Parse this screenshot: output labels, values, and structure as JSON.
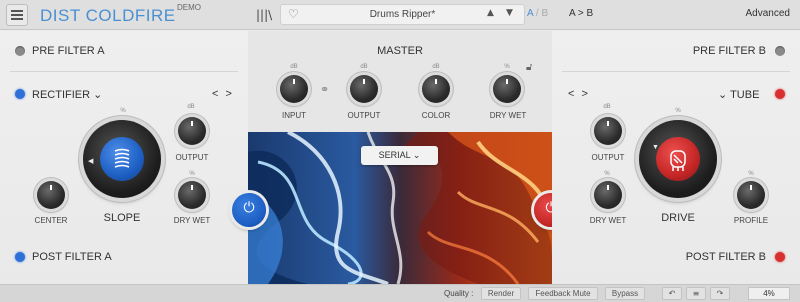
{
  "topbar": {
    "brand": "DIST COLDFIRE",
    "demo": "DEMO",
    "preset_name": "Drums Ripper*",
    "ab_a": "A",
    "ab_sep": "/",
    "ab_b": "B",
    "a_to_b": "A > B",
    "advanced": "Advanced",
    "icons": [
      "menu-icon",
      "library-icon",
      "heart-icon",
      "arrow-up-icon",
      "arrow-down-icon"
    ]
  },
  "left": {
    "pre_filter": "PRE FILTER A",
    "mode": "RECTIFIER",
    "mode_arrow": "⌄",
    "nav": "< >",
    "output": "OUTPUT",
    "output_unit": "dB",
    "slope": "SLOPE",
    "slope_unit": "%",
    "center": "CENTER",
    "drywet": "DRY WET",
    "drywet_unit": "%",
    "post_filter": "POST FILTER A",
    "pre_filter_led": "#8a8a8a",
    "mode_led": "#2e6fd8",
    "post_filter_led": "#2e6fd8"
  },
  "master": {
    "title": "MASTER",
    "input": "INPUT",
    "input_unit": "dB",
    "output": "OUTPUT",
    "output_unit": "dB",
    "color": "COLOR",
    "color_unit": "dB",
    "drywet": "DRY  WET",
    "drywet_unit": "%",
    "serial": "SERIAL",
    "link_icon": "link-icon",
    "lock_icon": "lock-icon"
  },
  "right": {
    "pre_filter": "PRE FILTER B",
    "mode": "TUBE",
    "nav": "< >",
    "output": "OUTPUT",
    "output_unit": "dB",
    "drive": "DRIVE",
    "drive_unit": "%",
    "drywet": "DRY WET",
    "drywet_unit": "%",
    "profile": "PROFILE",
    "profile_unit": "%",
    "post_filter": "POST FILTER B",
    "pre_filter_led": "#8a8a8a",
    "mode_led": "#d83030",
    "post_filter_led": "#d83030"
  },
  "bottombar": {
    "quality": "Quality :",
    "render": "Render",
    "feedback_mute": "Feedback Mute",
    "bypass": "Bypass",
    "undo": "↶",
    "history": "≡",
    "redo": "↷",
    "cpu": "4%"
  },
  "colors": {
    "accent_blue": "#4a90d0",
    "power_blue": "#1d5fc4",
    "power_red": "#c42626"
  }
}
